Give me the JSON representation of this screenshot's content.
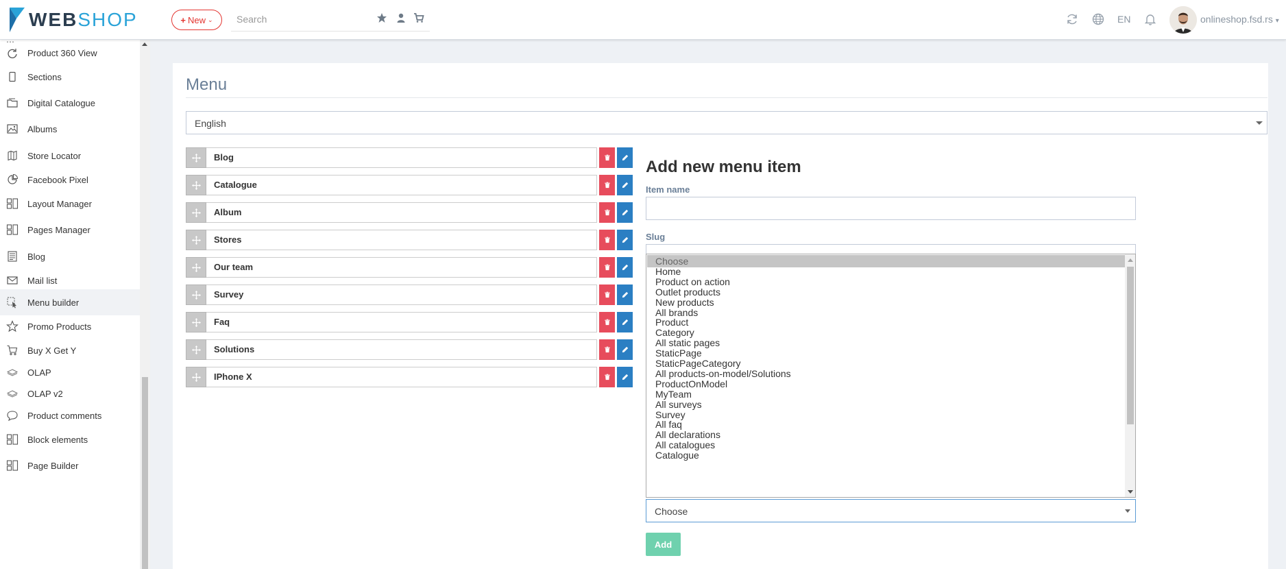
{
  "header": {
    "logo_web": "WEB",
    "logo_shop": "SHOP",
    "new_button": "New",
    "search_placeholder": "Search",
    "language": "EN",
    "account": "onlineshop.fsd.rs"
  },
  "sidebar": {
    "items": [
      {
        "label": "Product 360 View",
        "icon": "rotate-icon"
      },
      {
        "label": "Sections",
        "icon": "tablet-icon"
      },
      {
        "label": "Digital Catalogue",
        "icon": "folder-icon"
      },
      {
        "label": "Albums",
        "icon": "image-icon"
      },
      {
        "label": "Store Locator",
        "icon": "map-icon"
      },
      {
        "label": "Facebook Pixel",
        "icon": "pie-chart-icon"
      },
      {
        "label": "Layout Manager",
        "icon": "layout-icon"
      },
      {
        "label": "Pages Manager",
        "icon": "layout-icon"
      },
      {
        "label": "Blog",
        "icon": "newspaper-icon"
      },
      {
        "label": "Mail list",
        "icon": "envelope-icon"
      },
      {
        "label": "Menu builder",
        "icon": "cursor-icon",
        "active": true
      },
      {
        "label": "Promo Products",
        "icon": "star-icon"
      },
      {
        "label": "Buy X Get Y",
        "icon": "cart-icon"
      },
      {
        "label": "OLAP",
        "icon": "layers-icon"
      },
      {
        "label": "OLAP v2",
        "icon": "layers-icon"
      },
      {
        "label": "Product comments",
        "icon": "comment-icon"
      },
      {
        "label": "Block elements",
        "icon": "layout-icon"
      },
      {
        "label": "Page Builder",
        "icon": "layout-icon"
      }
    ]
  },
  "main": {
    "title": "Menu",
    "language_select": "English",
    "menu_items": [
      "Blog",
      "Catalogue",
      "Album",
      "Stores",
      "Our team",
      "Survey",
      "Faq",
      "Solutions",
      "IPhone X"
    ],
    "form": {
      "title": "Add new menu item",
      "item_name_label": "Item name",
      "item_name_value": "",
      "slug_label": "Slug",
      "slug_options": [
        "Choose",
        "Home",
        "Product on action",
        "Outlet products",
        "New products",
        "All brands",
        "Product",
        "Category",
        "All static pages",
        "StaticPage",
        "StaticPageCategory",
        "All products-on-model/Solutions",
        "ProductOnModel",
        "MyTeam",
        "All surveys",
        "Survey",
        "All faq",
        "All declarations",
        "All catalogues",
        "Catalogue"
      ],
      "select_value": "Choose",
      "add_button": "Add"
    }
  },
  "colors": {
    "accent_blue": "#2b7fc3",
    "delete_red": "#e74c5c",
    "add_green": "#6fd1ae",
    "logo_blue": "#2aa3d8"
  }
}
